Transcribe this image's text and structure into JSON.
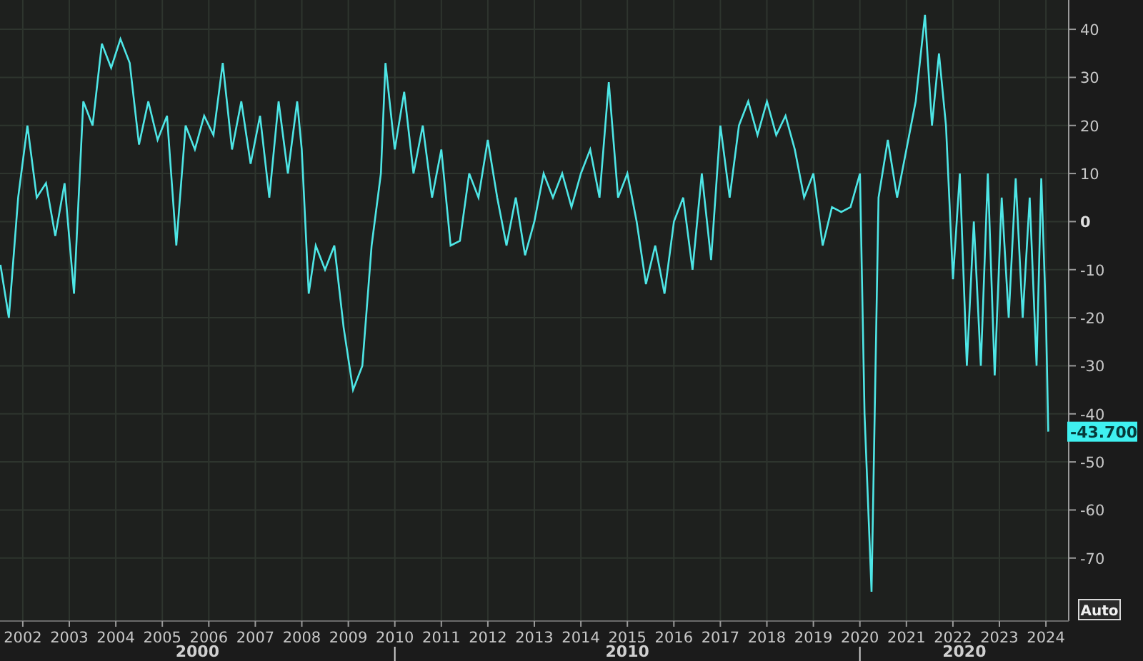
{
  "chart": {
    "chart_data": {
      "type": "line",
      "xlim": [
        2001.51,
        2024.49
      ],
      "ylim": [
        -83.1,
        46.1
      ],
      "yticks": [
        40,
        30,
        20,
        10,
        0,
        -10,
        -20,
        -30,
        -40,
        -50,
        -60,
        -70
      ],
      "xticks": [
        2002,
        2003,
        2004,
        2005,
        2006,
        2007,
        2008,
        2009,
        2010,
        2011,
        2012,
        2013,
        2014,
        2015,
        2016,
        2017,
        2018,
        2019,
        2020,
        2021,
        2022,
        2023,
        2024
      ],
      "grid": true,
      "x": [
        2001.52,
        2001.7,
        2001.9,
        2002.1,
        2002.3,
        2002.5,
        2002.7,
        2002.9,
        2003.1,
        2003.3,
        2003.5,
        2003.7,
        2003.9,
        2004.1,
        2004.3,
        2004.5,
        2004.7,
        2004.9,
        2005.1,
        2005.3,
        2005.5,
        2005.7,
        2005.9,
        2006.1,
        2006.3,
        2006.5,
        2006.7,
        2006.9,
        2007.1,
        2007.3,
        2007.5,
        2007.7,
        2007.9,
        2008.0,
        2008.15,
        2008.3,
        2008.5,
        2008.7,
        2008.9,
        2009.1,
        2009.3,
        2009.5,
        2009.7,
        2009.8,
        2010.0,
        2010.2,
        2010.4,
        2010.6,
        2010.8,
        2011.0,
        2011.2,
        2011.4,
        2011.6,
        2011.8,
        2012.0,
        2012.2,
        2012.4,
        2012.6,
        2012.8,
        2013.0,
        2013.2,
        2013.4,
        2013.6,
        2013.8,
        2014.0,
        2014.2,
        2014.4,
        2014.6,
        2014.8,
        2015.0,
        2015.2,
        2015.4,
        2015.6,
        2015.8,
        2016.0,
        2016.2,
        2016.4,
        2016.6,
        2016.8,
        2017.0,
        2017.2,
        2017.4,
        2017.6,
        2017.8,
        2018.0,
        2018.2,
        2018.4,
        2018.6,
        2018.8,
        2019.0,
        2019.2,
        2019.4,
        2019.6,
        2019.8,
        2020.0,
        2020.1,
        2020.25,
        2020.4,
        2020.6,
        2020.8,
        2021.0,
        2021.2,
        2021.4,
        2021.55,
        2021.7,
        2021.85,
        2022.0,
        2022.15,
        2022.3,
        2022.45,
        2022.6,
        2022.75,
        2022.9,
        2023.05,
        2023.2,
        2023.35,
        2023.5,
        2023.65,
        2023.8,
        2023.9,
        2024.0,
        2024.05
      ],
      "series": [
        {
          "color": "#4ee6e6",
          "values": [
            -9,
            -20,
            5,
            20,
            5,
            8,
            -3,
            8,
            -15,
            25,
            20,
            37,
            32,
            38,
            33,
            16,
            25,
            17,
            22,
            -5,
            20,
            15,
            22,
            18,
            33,
            15,
            25,
            12,
            22,
            5,
            25,
            10,
            25,
            15,
            -15,
            -5,
            -10,
            -5,
            -22,
            -35,
            -30,
            -5,
            10,
            33,
            15,
            27,
            10,
            20,
            5,
            15,
            -5,
            -4,
            10,
            5,
            17,
            5,
            -5,
            5,
            -7,
            0,
            10,
            5,
            10,
            3,
            10,
            15,
            5,
            29,
            5,
            10,
            0,
            -13,
            -5,
            -15,
            0,
            5,
            -10,
            10,
            -8,
            20,
            5,
            20,
            25,
            18,
            25,
            18,
            22,
            15,
            5,
            10,
            -5,
            3,
            2,
            3,
            10,
            -40,
            -77,
            5,
            17,
            5,
            15,
            25,
            43,
            20,
            35,
            20,
            -12,
            10,
            -30,
            0,
            -30,
            10,
            -32,
            5,
            -20,
            9,
            -20,
            5,
            -30,
            9,
            -20,
            -43.7
          ]
        }
      ]
    },
    "decade_labels": [
      "2000",
      "2010",
      "2020"
    ],
    "last_value_label": "-43.700",
    "auto_button": "Auto"
  }
}
